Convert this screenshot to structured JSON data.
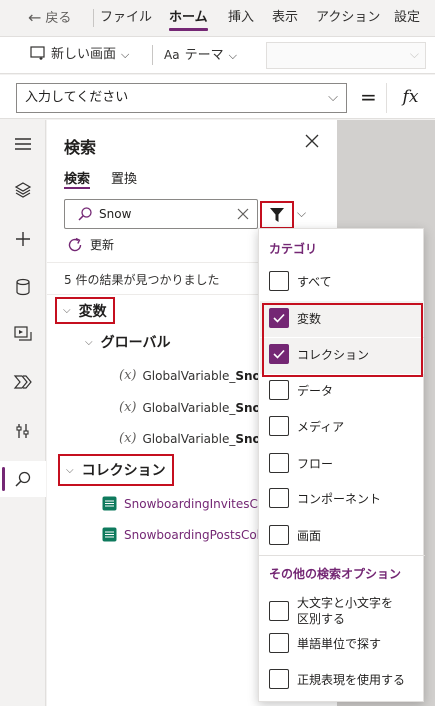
{
  "menubar": {
    "back_label": "戻る",
    "items": [
      {
        "label": "ファイル"
      },
      {
        "label": "ホーム",
        "active": true
      },
      {
        "label": "挿入"
      },
      {
        "label": "表示"
      },
      {
        "label": "アクション"
      },
      {
        "label": "設定"
      }
    ]
  },
  "toolbar": {
    "new_screen_label": "新しい画面",
    "theme_label": "テーマ"
  },
  "formula_bar": {
    "property_placeholder": "入力してください",
    "equals": "=",
    "fx": "fx"
  },
  "rail": {
    "icons": [
      "hamburger-menu-icon",
      "layers-icon",
      "insert-plus-icon",
      "data-cylinder-icon",
      "media-icon",
      "power-automate-icon",
      "tools-icon",
      "search-icon"
    ]
  },
  "search_pane": {
    "title": "検索",
    "tabs": [
      {
        "label": "検索",
        "active": true
      },
      {
        "label": "置換"
      }
    ],
    "search_value": "Snow",
    "refresh_label": "更新",
    "results_text": "5 件の結果が見つかりました",
    "groups": {
      "variables": {
        "label": "変数",
        "subgroup_label": "グローバル",
        "items": [
          {
            "prefix": "GlobalVariable_",
            "match": "Snowb"
          },
          {
            "prefix": "GlobalVariable_",
            "match": "Snowb"
          },
          {
            "prefix": "GlobalVariable_",
            "match": "Snowb"
          }
        ]
      },
      "collections": {
        "label": "コレクション",
        "items": [
          {
            "match": "Snow",
            "rest": "boardingInvitesColle"
          },
          {
            "match": "Snow",
            "rest": "boardingPostsColle"
          }
        ]
      }
    }
  },
  "filter_menu": {
    "category_header": "カテゴリ",
    "categories": [
      {
        "label": "すべて",
        "checked": false
      },
      {
        "label": "変数",
        "checked": true
      },
      {
        "label": "コレクション",
        "checked": true
      },
      {
        "label": "データ",
        "checked": false
      },
      {
        "label": "メディア",
        "checked": false
      },
      {
        "label": "フロー",
        "checked": false
      },
      {
        "label": "コンポーネント",
        "checked": false
      },
      {
        "label": "画面",
        "checked": false
      }
    ],
    "other_header": "その他の検索オプション",
    "options": [
      {
        "label_line1": "大文字と小文字を",
        "label_line2": "区別する",
        "checked": false
      },
      {
        "label": "単語単位で探す",
        "checked": false
      },
      {
        "label": "正規表現を使用する",
        "checked": false
      }
    ]
  },
  "colors": {
    "accent": "#742774",
    "highlight_border": "#c50f1f"
  }
}
